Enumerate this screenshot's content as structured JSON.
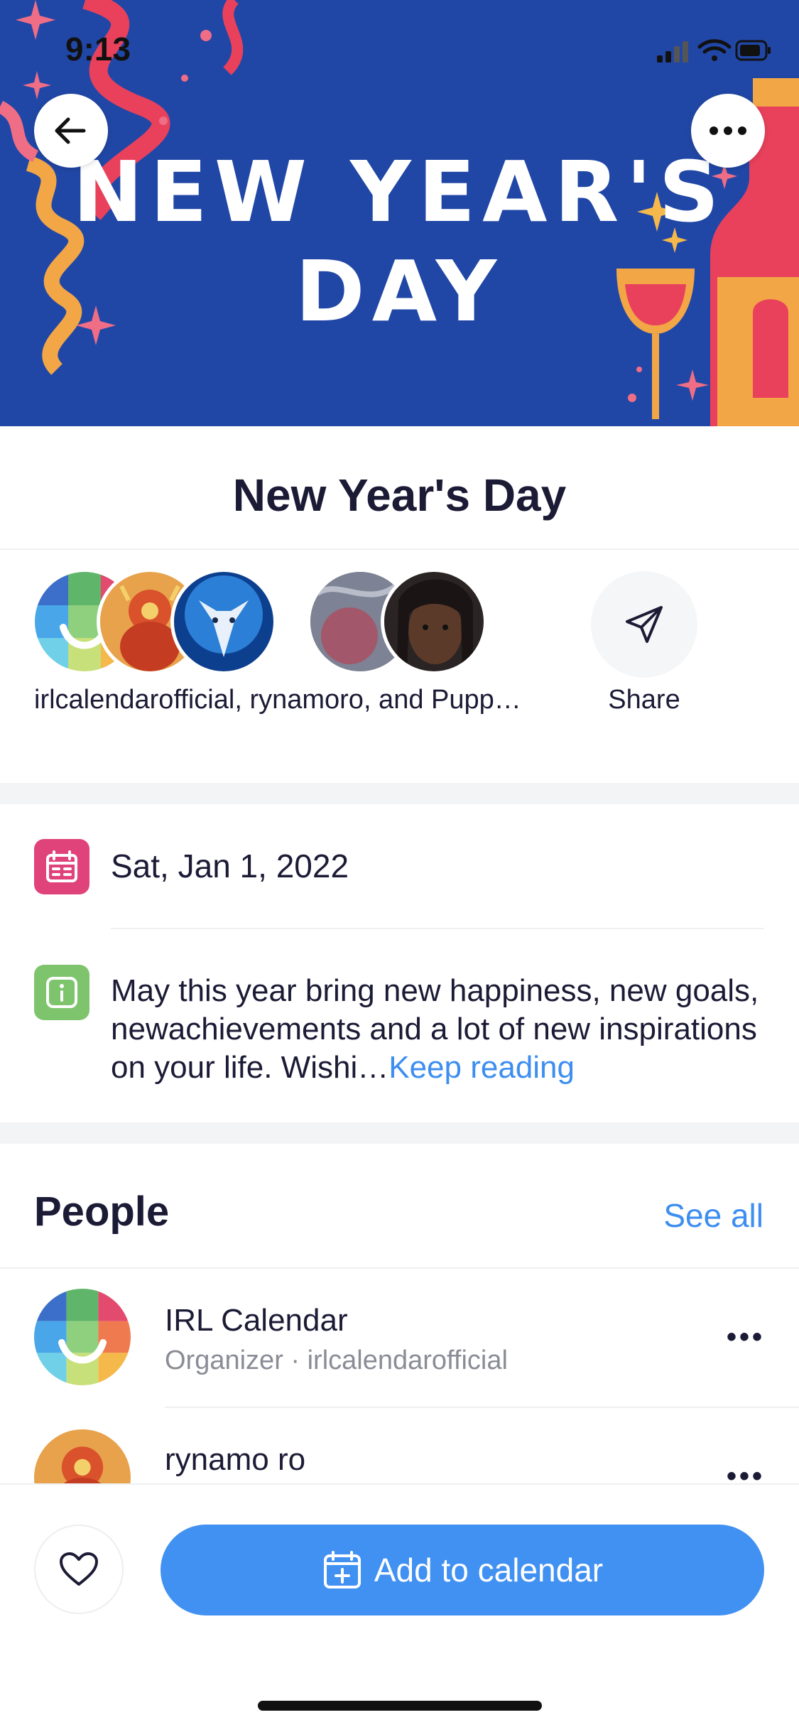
{
  "status_bar": {
    "time": "9:13"
  },
  "hero": {
    "line1": "NEW YEAR'S",
    "line2": "DAY",
    "bg_color": "#2147a6"
  },
  "event": {
    "title": "New Year's Day"
  },
  "attendees": {
    "summary": "irlcalendarofficial, rynamoro, and Pupp…",
    "share_label": "Share"
  },
  "details": {
    "date": "Sat, Jan 1, 2022",
    "description": "May this year bring new happiness, new goals, newachievements and a lot of new inspirations on your life. Wishi…",
    "keep_reading": "Keep reading"
  },
  "people": {
    "heading": "People",
    "see_all": "See all",
    "list": [
      {
        "name": "IRL Calendar",
        "subtitle": "Organizer · irlcalendarofficial",
        "more": "•••"
      },
      {
        "name": "rynamo ro",
        "subtitle": "",
        "more": "•••"
      }
    ]
  },
  "footer": {
    "add_label": "Add to calendar"
  },
  "colors": {
    "accent": "#4191f2",
    "link": "#3d8ef0",
    "calendar_icon": "#e0427a",
    "info_icon": "#7ec46c"
  },
  "icons": [
    "back-arrow-icon",
    "more-icon",
    "share-icon",
    "calendar-icon",
    "info-icon",
    "heart-icon",
    "calendar-add-icon"
  ]
}
